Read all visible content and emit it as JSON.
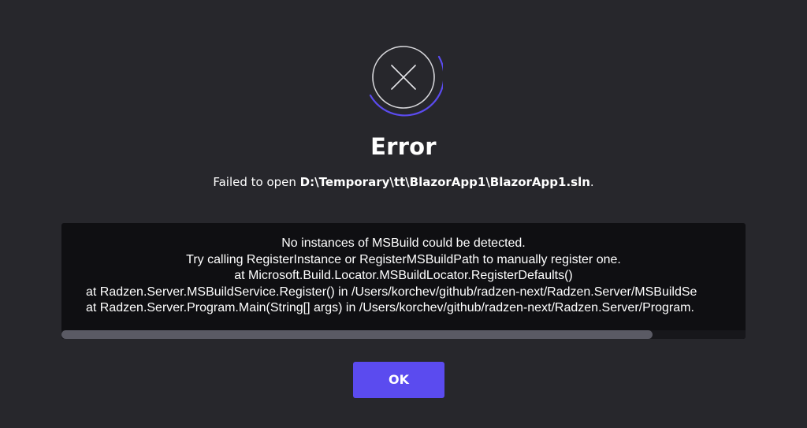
{
  "dialog": {
    "icon": "close-circle-icon",
    "accent_color": "#5b4bef",
    "background_color": "#27272c",
    "title": "Error",
    "message": {
      "prefix": "Failed to open ",
      "path": "D:\\Temporary\\tt\\BlazorApp1\\BlazorApp1.sln",
      "suffix": "."
    },
    "details": {
      "lines": [
        "No instances of MSBuild could be detected.",
        "Try calling RegisterInstance or RegisterMSBuildPath to manually register one.",
        "at Microsoft.Build.Locator.MSBuildLocator.RegisterDefaults()",
        "at Radzen.Server.MSBuildService.Register() in /Users/korchev/github/radzen-next/Radzen.Server/MSBuildSe",
        "at Radzen.Server.Program.Main(String[] args) in /Users/korchev/github/radzen-next/Radzen.Server/Program."
      ]
    },
    "ok_label": "OK"
  }
}
